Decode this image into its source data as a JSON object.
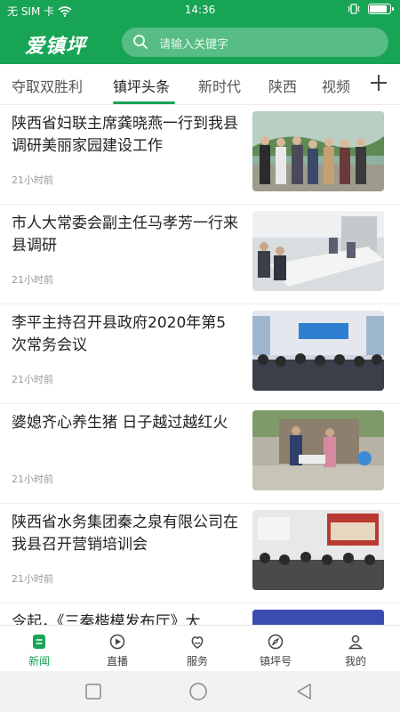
{
  "status_bar": {
    "carrier": "无 SIM 卡",
    "time": "14:36",
    "battery_level": 0.9
  },
  "header": {
    "logo": "爱镇坪",
    "search_placeholder": "请输入关键字",
    "search_icon": "search-icon"
  },
  "tabs": [
    {
      "label": "夺取双胜利",
      "active": false
    },
    {
      "label": "镇坪头条",
      "active": true
    },
    {
      "label": "新时代",
      "active": false
    },
    {
      "label": "陕西",
      "active": false
    },
    {
      "label": "视频",
      "active": false
    }
  ],
  "add_tab_icon": "plus-icon",
  "news": [
    {
      "title": "陕西省妇联主席龚晓燕一行到我县调研美丽家园建设工作",
      "time": "21小时前",
      "thumb": "group-outdoor-photo"
    },
    {
      "title": "市人大常委会副主任马孝芳一行来县调研",
      "time": "21小时前",
      "thumb": "meeting-room-photo"
    },
    {
      "title": "李平主持召开县政府2020年第5次常务会议",
      "time": "21小时前",
      "thumb": "conference-hall-photo"
    },
    {
      "title": "婆媳齐心养生猪 日子越过越红火",
      "time": "21小时前",
      "thumb": "farm-photo"
    },
    {
      "title": "陕西省水务集团秦之泉有限公司在我县召开营销培训会",
      "time": "21小时前",
      "thumb": "training-room-photo"
    },
    {
      "title": "令起，《三秦楷模发布厅》大",
      "time": "",
      "thumb": "broadcast-photo"
    }
  ],
  "bottom_nav": [
    {
      "label": "新闻",
      "icon": "news-icon",
      "active": true
    },
    {
      "label": "直播",
      "icon": "live-icon",
      "active": false
    },
    {
      "label": "服务",
      "icon": "service-icon",
      "active": false
    },
    {
      "label": "镇坪号",
      "icon": "compass-icon",
      "active": false
    },
    {
      "label": "我的",
      "icon": "user-icon",
      "active": false
    }
  ],
  "colors": {
    "brand_green": "#17a455",
    "text_primary": "#222222",
    "text_meta": "#999999"
  }
}
